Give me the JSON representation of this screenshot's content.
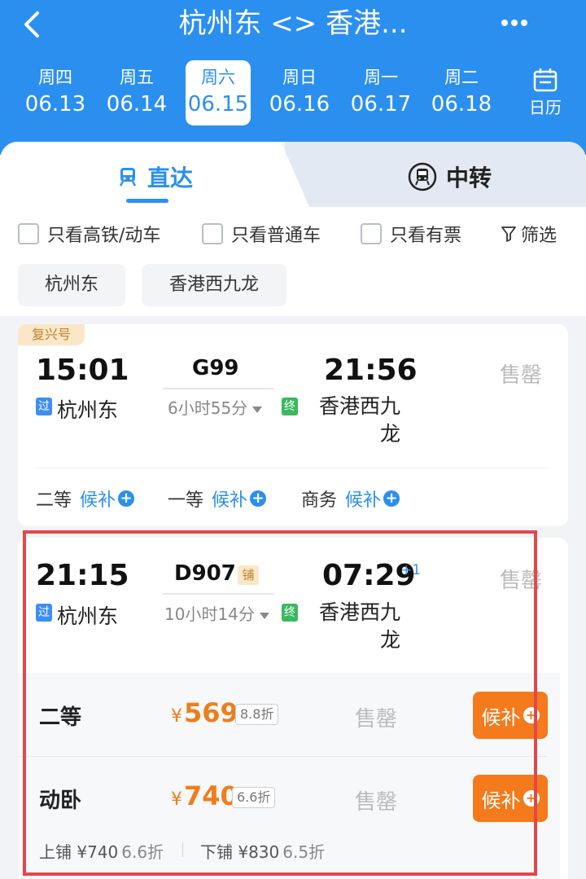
{
  "header": {
    "title": "杭州东 <> 香港...",
    "calendar_label": "日历"
  },
  "dates": [
    {
      "weekday": "周四",
      "date": "06.13"
    },
    {
      "weekday": "周五",
      "date": "06.14"
    },
    {
      "weekday": "周六",
      "date": "06.15",
      "selected": true
    },
    {
      "weekday": "周日",
      "date": "06.16"
    },
    {
      "weekday": "周一",
      "date": "06.17"
    },
    {
      "weekday": "周二",
      "date": "06.18"
    }
  ],
  "tabs": {
    "direct": "直达",
    "transfer": "中转"
  },
  "filters": {
    "high_speed": "只看高铁/动车",
    "normal": "只看普通车",
    "available": "只看有票",
    "filter": "筛选"
  },
  "stations": {
    "from": "杭州东",
    "to": "香港西九龙"
  },
  "trains": [
    {
      "badge": "复兴号",
      "depart": "15:01",
      "number": "G99",
      "duration": "6小时55分",
      "arrive": "21:56",
      "from_tag": "过",
      "from": "杭州东",
      "to_tag": "终",
      "to": "香港西九龙",
      "status": "售罄",
      "seats": [
        {
          "name": "二等",
          "action": "候补"
        },
        {
          "name": "一等",
          "action": "候补"
        },
        {
          "name": "商务",
          "action": "候补"
        }
      ]
    },
    {
      "depart": "21:15",
      "number": "D907",
      "sleeper_tag": "铺",
      "duration": "10小时14分",
      "arrive": "07:29",
      "day_offset": "+1",
      "from_tag": "过",
      "from": "杭州东",
      "to_tag": "终",
      "to": "香港西九龙",
      "status": "售罄",
      "seats": [
        {
          "name": "二等",
          "currency": "¥",
          "price": "569",
          "discount": "8.8折",
          "status": "售罄",
          "action": "候补"
        },
        {
          "name": "动卧",
          "currency": "¥",
          "price": "740",
          "discount": "6.6折",
          "status": "售罄",
          "action": "候补"
        }
      ],
      "berths": [
        {
          "label": "上铺 ¥740",
          "discount": "6.6折"
        },
        {
          "label": "下铺 ¥830",
          "discount": "6.5折"
        }
      ]
    }
  ],
  "colors": {
    "primary": "#2b8ff0",
    "price": "#f07d1a",
    "highlight": "#e2474b"
  }
}
